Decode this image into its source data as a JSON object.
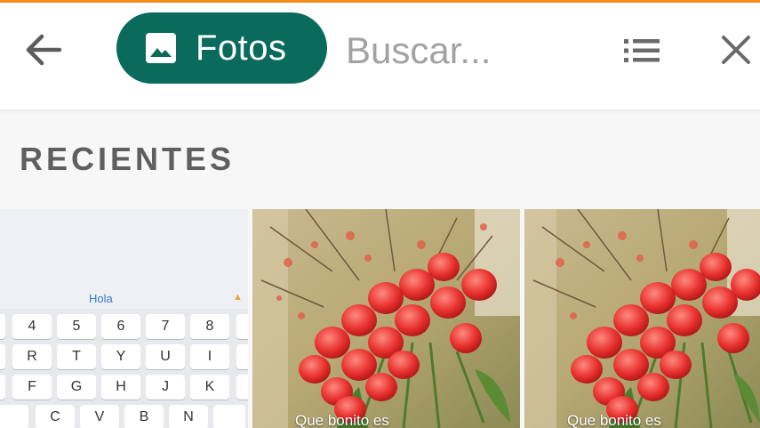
{
  "toolbar": {
    "back_icon": "arrow-left-icon",
    "chip_label": "Fotos",
    "chip_icon": "image-icon",
    "chip_color": "#0a6b5c",
    "search_placeholder": "Buscar...",
    "list_icon": "list-icon",
    "close_icon": "close-icon"
  },
  "section": {
    "title": "RECIENTES"
  },
  "thumbnails": [
    {
      "type": "keyboard-screenshot",
      "suggestion": "Hola",
      "keys_row1": [
        "4",
        "5",
        "6",
        "7",
        "8"
      ],
      "keys_row2": [
        "R",
        "T",
        "Y",
        "U",
        "I"
      ],
      "keys_row3": [
        "F",
        "G",
        "H",
        "J",
        "K"
      ],
      "keys_row4": [
        "C",
        "V",
        "B",
        "N"
      ]
    },
    {
      "type": "photo",
      "caption": "Que bonito es"
    },
    {
      "type": "photo",
      "caption": "Que bonito es"
    }
  ]
}
